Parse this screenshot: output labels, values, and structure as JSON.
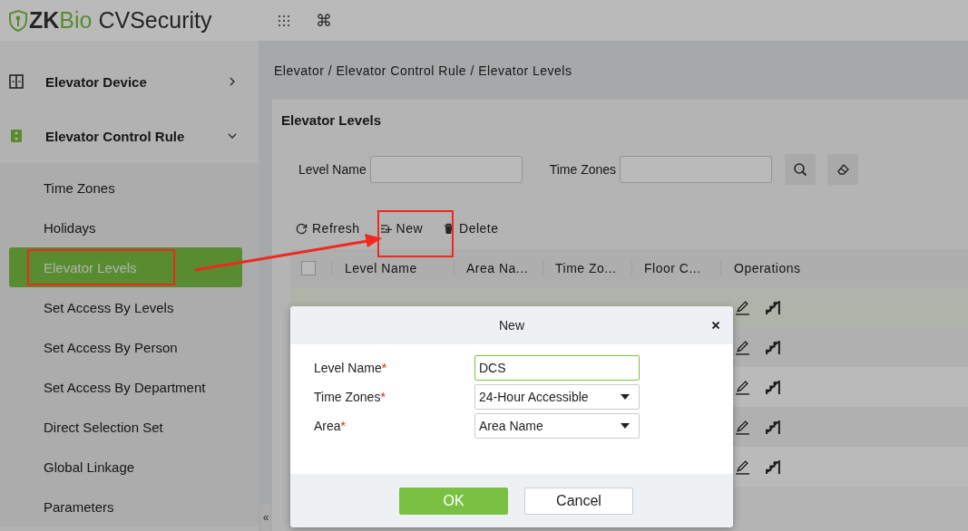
{
  "header": {
    "logo": {
      "brand_dark": "ZK",
      "brand_accent": "Bio",
      "product": "CVSecurity"
    },
    "shortcut_glyph": "⌘"
  },
  "sidebar": {
    "menus": [
      {
        "label": "Elevator Device",
        "kind": "device",
        "expanded": false
      },
      {
        "label": "Elevator Control Rule",
        "kind": "rule",
        "expanded": true,
        "children": [
          {
            "label": "Time Zones",
            "selected": false,
            "highlighted": false
          },
          {
            "label": "Holidays",
            "selected": false,
            "highlighted": false
          },
          {
            "label": "Elevator Levels",
            "selected": true,
            "highlighted": true
          },
          {
            "label": "Set Access By Levels",
            "selected": false,
            "highlighted": false
          },
          {
            "label": "Set Access By Person",
            "selected": false,
            "highlighted": false
          },
          {
            "label": "Set Access By Department",
            "selected": false,
            "highlighted": false
          },
          {
            "label": "Direct Selection Set",
            "selected": false,
            "highlighted": false
          },
          {
            "label": "Global Linkage",
            "selected": false,
            "highlighted": false
          },
          {
            "label": "Parameters",
            "selected": false,
            "highlighted": false
          }
        ]
      }
    ],
    "collapse_glyph": "«"
  },
  "breadcrumb": "Elevator / Elevator Control Rule / Elevator Levels",
  "panel": {
    "title": "Elevator Levels",
    "filters": [
      {
        "label": "Level Name"
      },
      {
        "label": "Time Zones"
      }
    ],
    "toolbar": [
      {
        "kind": "refresh",
        "label": "Refresh",
        "highlighted": false
      },
      {
        "kind": "new",
        "label": "New",
        "highlighted": true
      },
      {
        "kind": "delete",
        "label": "Delete",
        "highlighted": false
      }
    ],
    "table": {
      "select_all_checked": false,
      "columns": [
        "Level Name",
        "Area Na...",
        "Time Zo...",
        "Floor C...",
        "Operations"
      ],
      "rows": [
        {
          "selected": true
        },
        {
          "selected": false
        },
        {
          "selected": false
        },
        {
          "selected": false
        },
        {
          "selected": false
        }
      ]
    }
  },
  "dialog": {
    "title": "New",
    "fields": [
      {
        "label": "Level Name",
        "mark": "*",
        "kind": "text",
        "value": "DCS",
        "focused": true
      },
      {
        "label": "Time Zones",
        "mark": "*",
        "kind": "select",
        "value": "24-Hour Accessible",
        "focused": false
      },
      {
        "label": "Area",
        "mark": "*",
        "kind": "select",
        "value": "Area Name",
        "focused": false
      }
    ],
    "buttons": [
      {
        "label": "OK",
        "kind": "primary"
      },
      {
        "label": "Cancel",
        "kind": "secondary"
      }
    ]
  }
}
